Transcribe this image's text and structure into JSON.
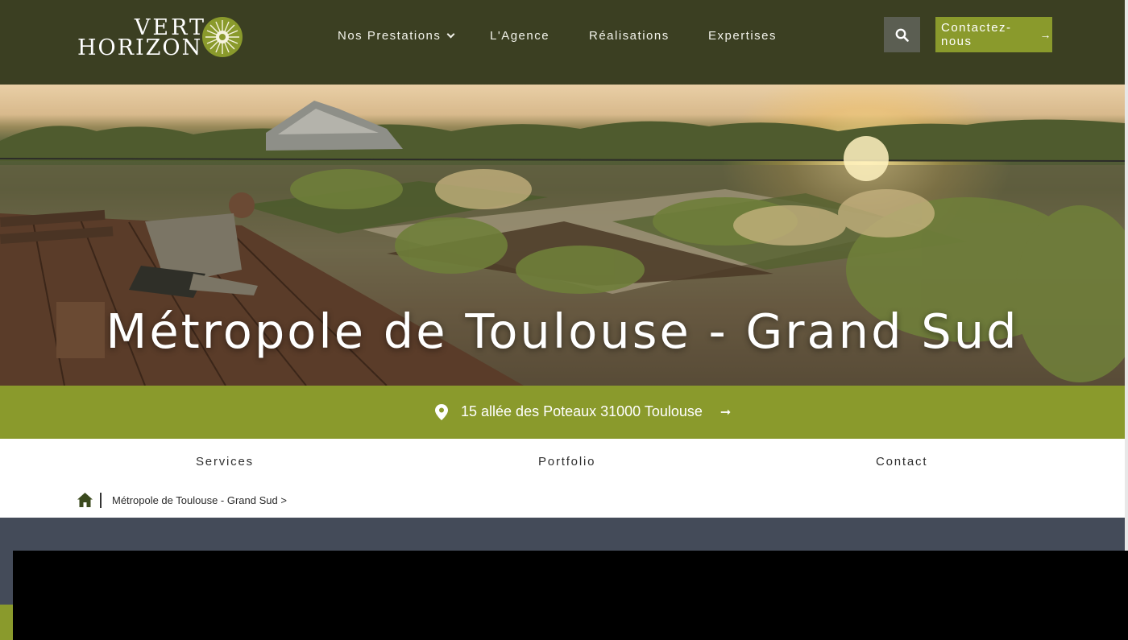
{
  "header": {
    "logo": {
      "line1": "VERT",
      "line2": "HORIZON"
    },
    "nav": [
      {
        "label": "Nos Prestations",
        "has_dropdown": true
      },
      {
        "label": "L'Agence"
      },
      {
        "label": "Réalisations"
      },
      {
        "label": "Expertises"
      }
    ],
    "search_icon": "search-icon",
    "contact_button": "Contactez-nous",
    "contact_arrow": "→"
  },
  "hero": {
    "title": "Métropole de Toulouse - Grand Sud"
  },
  "address_bar": {
    "address": "15 allée des Poteaux 31000 Toulouse",
    "arrow": "➞"
  },
  "subnav": {
    "items": [
      "Services",
      "Portfolio",
      "Contact"
    ]
  },
  "breadcrumb": {
    "home_icon": "home-icon",
    "current": "Métropole de Toulouse - Grand Sud >"
  },
  "colors": {
    "header_bg": "#3b3f22",
    "accent_green": "#8a9a2c",
    "search_bg": "#5b5e52",
    "slate_bg": "#444b59"
  }
}
